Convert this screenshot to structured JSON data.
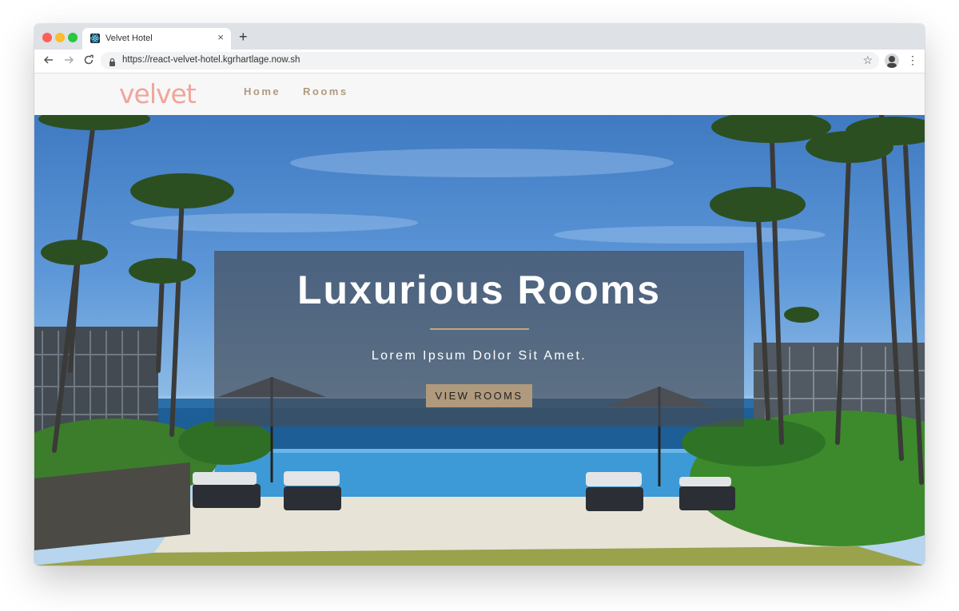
{
  "browser": {
    "tab_title": "Velvet Hotel",
    "tab_close": "×",
    "new_tab": "+",
    "url": "https://react-velvet-hotel.kgrhartlage.now.sh",
    "icons": {
      "back": "arrow-left",
      "forward": "arrow-right",
      "reload": "reload",
      "lock": "lock",
      "bookmark": "star",
      "menu": "vertical-dots"
    }
  },
  "site": {
    "logo": "velvet",
    "nav": [
      {
        "label": "Home"
      },
      {
        "label": "Rooms"
      }
    ],
    "colors": {
      "logo": "#f0a59b",
      "accent": "#af9a7d"
    }
  },
  "hero": {
    "title": "Luxurious Rooms",
    "subtitle": "Lorem Ipsum Dolor Sit Amet.",
    "button_label": "VIEW ROOMS"
  }
}
